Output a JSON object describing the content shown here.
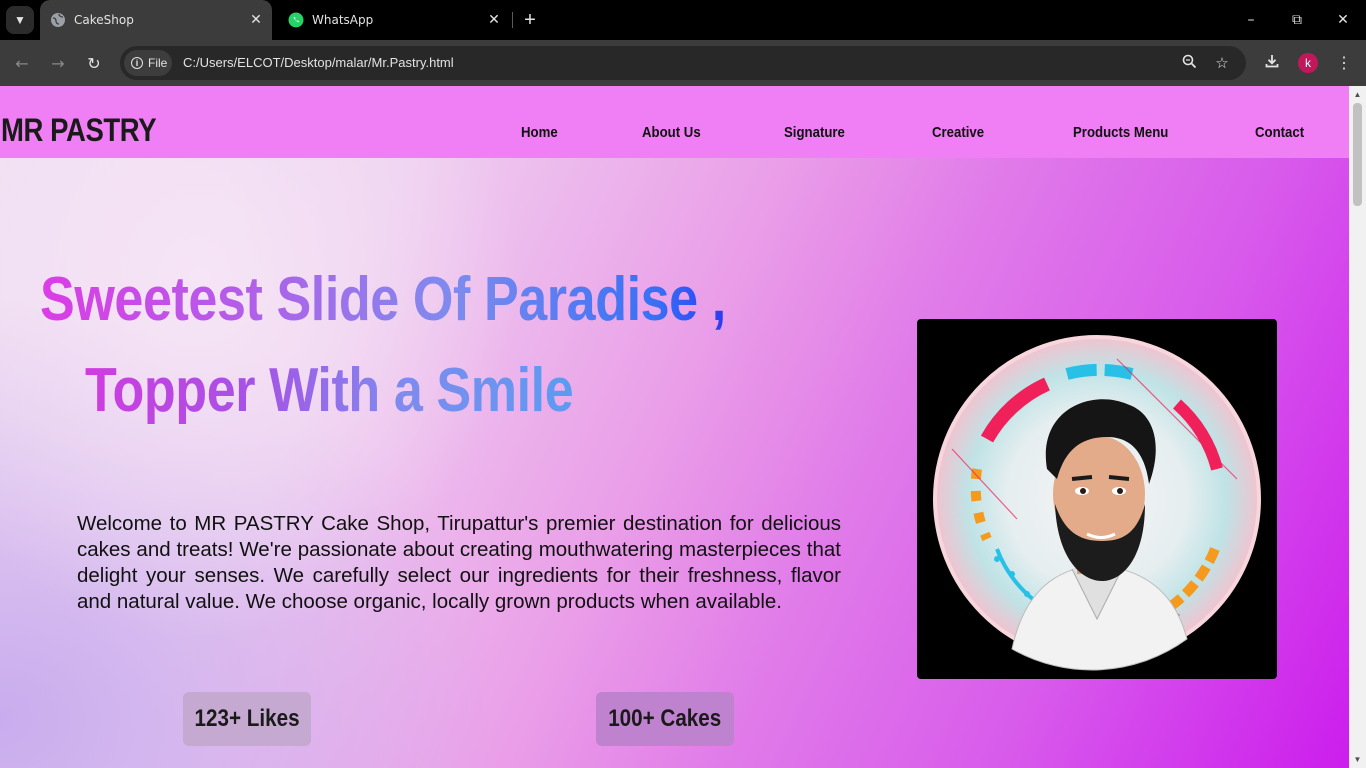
{
  "browser": {
    "tabs": [
      {
        "title": "CakeShop",
        "active": true,
        "icon": "globe-icon"
      },
      {
        "title": "WhatsApp",
        "active": false,
        "icon": "whatsapp-icon"
      }
    ],
    "address_chip": "File",
    "url": "C:/Users/ELCOT/Desktop/malar/Mr.Pastry.html",
    "profile_initial": "k"
  },
  "site": {
    "brand": "MR PASTRY",
    "nav": [
      "Home",
      "About Us",
      "Signature",
      "Creative",
      "Products Menu",
      "Contact"
    ],
    "headline_line1": "Sweetest Slide Of Paradise ,",
    "headline_line2": "Topper With a Smile",
    "intro": "Welcome to MR PASTRY Cake Shop, Tirupattur's premier destination for delicious cakes and treats! We're passionate about creating mouthwatering masterpieces that delight your senses. We carefully select our ingredients for their freshness, flavor and natural value. We choose organic, locally grown products when available.",
    "stats": {
      "likes": "123+ Likes",
      "cakes": "100+ Cakes"
    }
  },
  "colors": {
    "header_bg": "#f07ef5",
    "hero_accent": "#cc1ded",
    "likes_badge": "#c5a9d0",
    "cakes_badge": "#bf82cf"
  }
}
